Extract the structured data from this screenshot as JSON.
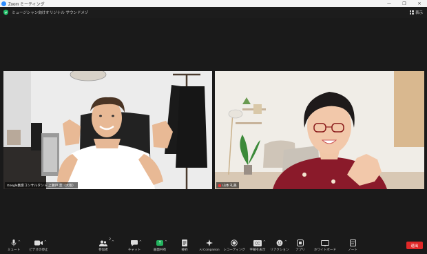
{
  "window": {
    "title": "Zoom ミーティング"
  },
  "meeting": {
    "name": "ミュージシャン向けオリジナル サウンドメゾ",
    "view_label": "表示"
  },
  "participants": [
    {
      "name": "Google集客コンサルタント 上瀬戸 圭（大阪）"
    },
    {
      "name": "山本 礼美"
    }
  ],
  "toolbar": {
    "mute_label": "ミュート",
    "video_label": "ビデオの停止",
    "participants_label": "参加者",
    "participants_count": "2",
    "chat_label": "チャット",
    "share_label": "画面共有",
    "summary_label": "要約",
    "ai_label": "AI Companion",
    "record_label": "レコーディング",
    "captions_label": "字幕を表示",
    "reactions_label": "リアクション",
    "apps_label": "アプリ",
    "whiteboard_label": "ホワイトボード",
    "notes_label": "ノート",
    "end_label": "退出"
  },
  "colors": {
    "accent": "#2d8cff",
    "share": "#22b35e",
    "end": "#e02828",
    "shield": "#23c16b"
  }
}
